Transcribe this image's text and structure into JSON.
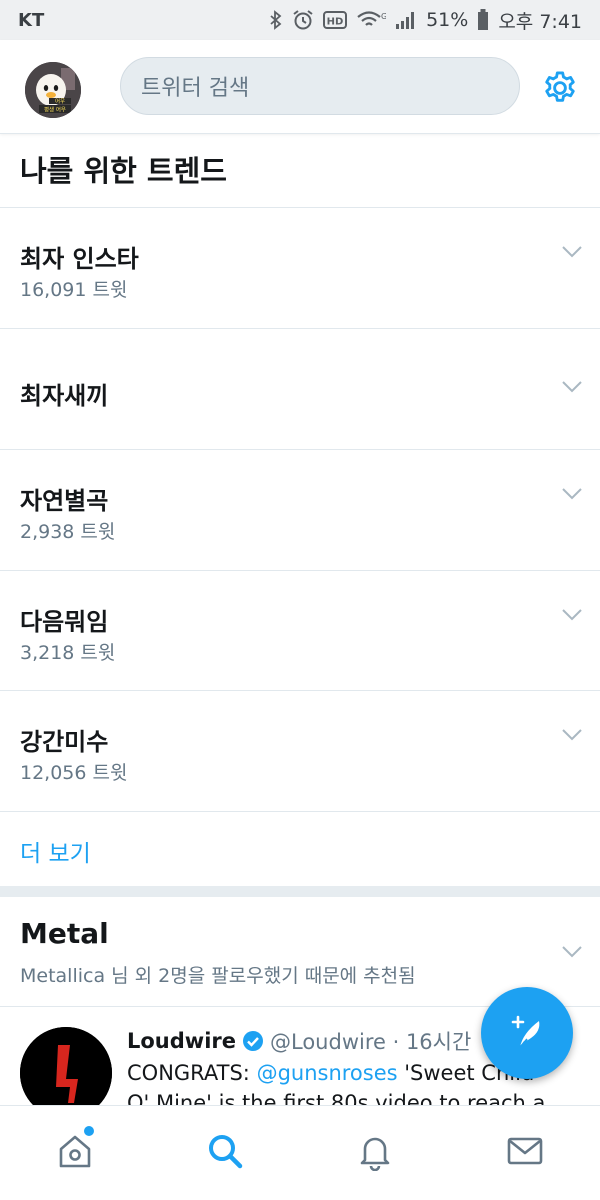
{
  "status_bar": {
    "carrier": "KT",
    "battery": "51%",
    "time": "오후 7:41"
  },
  "header": {
    "avatar_text_1": "어우",
    "avatar_text_2": "평생 어우",
    "search_placeholder": "트위터 검색"
  },
  "trends": {
    "title": "나를 위한 트렌드",
    "items": [
      {
        "name": "최자 인스타",
        "count": "16,091 트윗"
      },
      {
        "name": "최자새끼",
        "count": ""
      },
      {
        "name": "자연별곡",
        "count": "2,938 트윗"
      },
      {
        "name": "다음뭐임",
        "count": "3,218 트윗"
      },
      {
        "name": "강간미수",
        "count": "12,056 트윗"
      }
    ],
    "more_label": "더 보기"
  },
  "topic": {
    "title": "Metal",
    "subtitle": "Metallica 님 외 2명을 팔로우했기 때문에 추천됨"
  },
  "tweet": {
    "name": "Loudwire",
    "handle": "@Loudwire · 16시간",
    "line1_prefix": "CONGRATS: ",
    "line1_mention": "@gunsnroses",
    "line1_suffix": " 'Sweet Child",
    "line2": "O' Mine' is the first 80s video to reach a"
  },
  "colors": {
    "accent": "#1da1f2",
    "secondary_text": "#657786",
    "primary_text": "#14171a",
    "divider": "#e1e8ed"
  },
  "icons": {
    "nav": [
      "home-icon",
      "search-icon",
      "bell-icon",
      "mail-icon"
    ],
    "header_right": "gear-icon",
    "fab": "compose-tweet-icon"
  }
}
